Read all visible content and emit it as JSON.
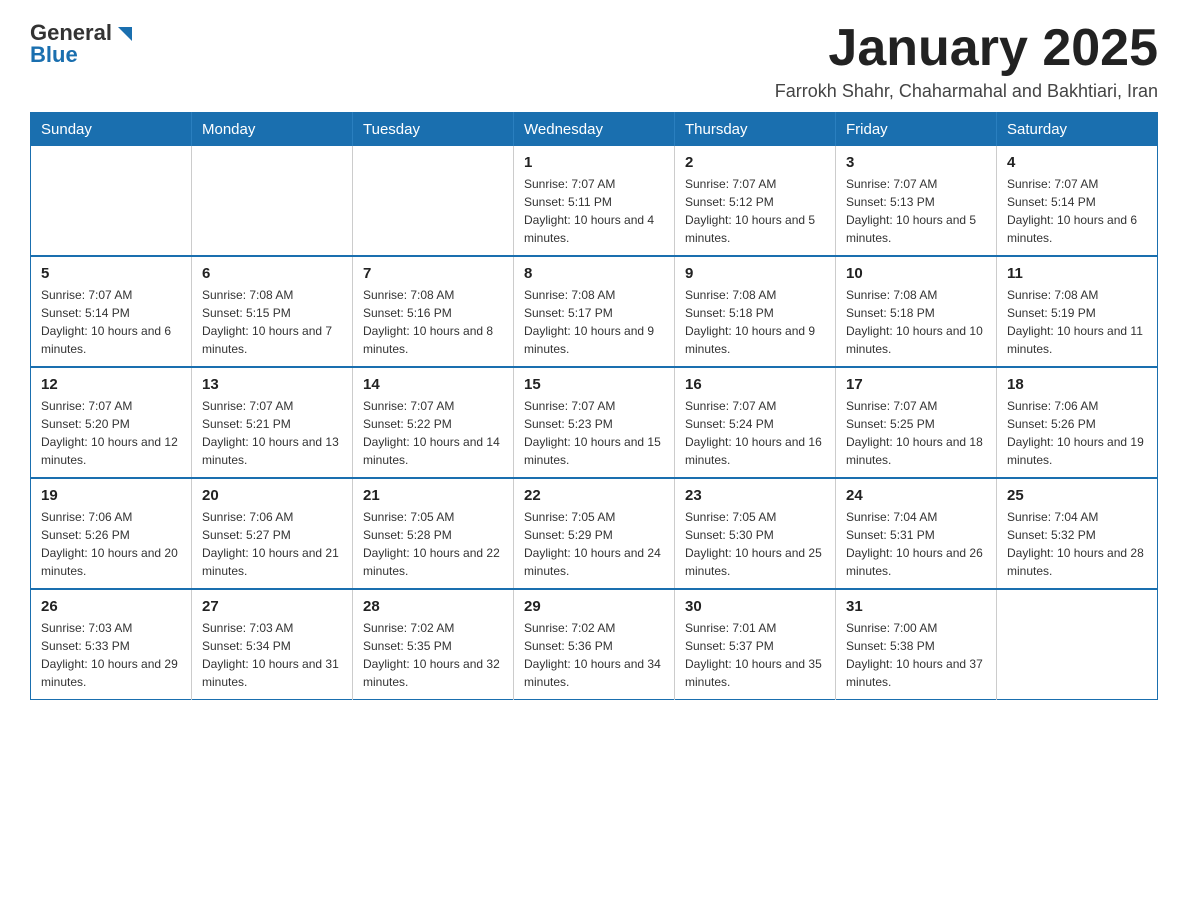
{
  "logo": {
    "general": "General",
    "blue": "Blue"
  },
  "header": {
    "title": "January 2025",
    "subtitle": "Farrokh Shahr, Chaharmahal and Bakhtiari, Iran"
  },
  "days_of_week": [
    "Sunday",
    "Monday",
    "Tuesday",
    "Wednesday",
    "Thursday",
    "Friday",
    "Saturday"
  ],
  "weeks": [
    [
      null,
      null,
      null,
      {
        "num": "1",
        "info": "Sunrise: 7:07 AM\nSunset: 5:11 PM\nDaylight: 10 hours and 4 minutes."
      },
      {
        "num": "2",
        "info": "Sunrise: 7:07 AM\nSunset: 5:12 PM\nDaylight: 10 hours and 5 minutes."
      },
      {
        "num": "3",
        "info": "Sunrise: 7:07 AM\nSunset: 5:13 PM\nDaylight: 10 hours and 5 minutes."
      },
      {
        "num": "4",
        "info": "Sunrise: 7:07 AM\nSunset: 5:14 PM\nDaylight: 10 hours and 6 minutes."
      }
    ],
    [
      {
        "num": "5",
        "info": "Sunrise: 7:07 AM\nSunset: 5:14 PM\nDaylight: 10 hours and 6 minutes."
      },
      {
        "num": "6",
        "info": "Sunrise: 7:08 AM\nSunset: 5:15 PM\nDaylight: 10 hours and 7 minutes."
      },
      {
        "num": "7",
        "info": "Sunrise: 7:08 AM\nSunset: 5:16 PM\nDaylight: 10 hours and 8 minutes."
      },
      {
        "num": "8",
        "info": "Sunrise: 7:08 AM\nSunset: 5:17 PM\nDaylight: 10 hours and 9 minutes."
      },
      {
        "num": "9",
        "info": "Sunrise: 7:08 AM\nSunset: 5:18 PM\nDaylight: 10 hours and 9 minutes."
      },
      {
        "num": "10",
        "info": "Sunrise: 7:08 AM\nSunset: 5:18 PM\nDaylight: 10 hours and 10 minutes."
      },
      {
        "num": "11",
        "info": "Sunrise: 7:08 AM\nSunset: 5:19 PM\nDaylight: 10 hours and 11 minutes."
      }
    ],
    [
      {
        "num": "12",
        "info": "Sunrise: 7:07 AM\nSunset: 5:20 PM\nDaylight: 10 hours and 12 minutes."
      },
      {
        "num": "13",
        "info": "Sunrise: 7:07 AM\nSunset: 5:21 PM\nDaylight: 10 hours and 13 minutes."
      },
      {
        "num": "14",
        "info": "Sunrise: 7:07 AM\nSunset: 5:22 PM\nDaylight: 10 hours and 14 minutes."
      },
      {
        "num": "15",
        "info": "Sunrise: 7:07 AM\nSunset: 5:23 PM\nDaylight: 10 hours and 15 minutes."
      },
      {
        "num": "16",
        "info": "Sunrise: 7:07 AM\nSunset: 5:24 PM\nDaylight: 10 hours and 16 minutes."
      },
      {
        "num": "17",
        "info": "Sunrise: 7:07 AM\nSunset: 5:25 PM\nDaylight: 10 hours and 18 minutes."
      },
      {
        "num": "18",
        "info": "Sunrise: 7:06 AM\nSunset: 5:26 PM\nDaylight: 10 hours and 19 minutes."
      }
    ],
    [
      {
        "num": "19",
        "info": "Sunrise: 7:06 AM\nSunset: 5:26 PM\nDaylight: 10 hours and 20 minutes."
      },
      {
        "num": "20",
        "info": "Sunrise: 7:06 AM\nSunset: 5:27 PM\nDaylight: 10 hours and 21 minutes."
      },
      {
        "num": "21",
        "info": "Sunrise: 7:05 AM\nSunset: 5:28 PM\nDaylight: 10 hours and 22 minutes."
      },
      {
        "num": "22",
        "info": "Sunrise: 7:05 AM\nSunset: 5:29 PM\nDaylight: 10 hours and 24 minutes."
      },
      {
        "num": "23",
        "info": "Sunrise: 7:05 AM\nSunset: 5:30 PM\nDaylight: 10 hours and 25 minutes."
      },
      {
        "num": "24",
        "info": "Sunrise: 7:04 AM\nSunset: 5:31 PM\nDaylight: 10 hours and 26 minutes."
      },
      {
        "num": "25",
        "info": "Sunrise: 7:04 AM\nSunset: 5:32 PM\nDaylight: 10 hours and 28 minutes."
      }
    ],
    [
      {
        "num": "26",
        "info": "Sunrise: 7:03 AM\nSunset: 5:33 PM\nDaylight: 10 hours and 29 minutes."
      },
      {
        "num": "27",
        "info": "Sunrise: 7:03 AM\nSunset: 5:34 PM\nDaylight: 10 hours and 31 minutes."
      },
      {
        "num": "28",
        "info": "Sunrise: 7:02 AM\nSunset: 5:35 PM\nDaylight: 10 hours and 32 minutes."
      },
      {
        "num": "29",
        "info": "Sunrise: 7:02 AM\nSunset: 5:36 PM\nDaylight: 10 hours and 34 minutes."
      },
      {
        "num": "30",
        "info": "Sunrise: 7:01 AM\nSunset: 5:37 PM\nDaylight: 10 hours and 35 minutes."
      },
      {
        "num": "31",
        "info": "Sunrise: 7:00 AM\nSunset: 5:38 PM\nDaylight: 10 hours and 37 minutes."
      },
      null
    ]
  ]
}
